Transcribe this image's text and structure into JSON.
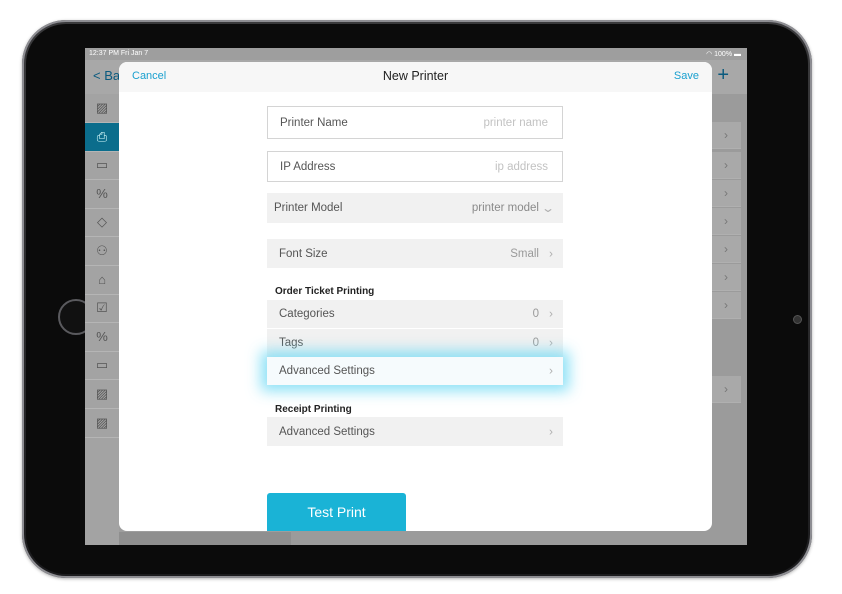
{
  "status_bar": {
    "time": "12:37 PM  Fri Jan 7",
    "battery": "100%"
  },
  "background": {
    "back_label": "< Ba",
    "add_label": "+"
  },
  "sidebar": {
    "items": [
      {
        "icon": "chart-icon",
        "glyph": "▨"
      },
      {
        "icon": "printer-icon",
        "glyph": "⎙",
        "active": true
      },
      {
        "icon": "tray-icon",
        "glyph": "▭"
      },
      {
        "icon": "discount-icon",
        "glyph": "%"
      },
      {
        "icon": "diamond-icon",
        "glyph": "◇"
      },
      {
        "icon": "users-icon",
        "glyph": "⚇"
      },
      {
        "icon": "store-icon",
        "glyph": "⌂"
      },
      {
        "icon": "clipboard-icon",
        "glyph": "☑"
      },
      {
        "icon": "percent-box-icon",
        "glyph": "%"
      },
      {
        "icon": "monitor-icon",
        "glyph": "▭"
      },
      {
        "icon": "chart-icon",
        "glyph": "▨"
      },
      {
        "icon": "chart-icon",
        "glyph": "▨"
      }
    ]
  },
  "modal": {
    "cancel": "Cancel",
    "title": "New Printer",
    "save": "Save",
    "printer_name": {
      "label": "Printer Name",
      "placeholder": "printer name"
    },
    "ip_address": {
      "label": "IP Address",
      "placeholder": "ip address"
    },
    "printer_model": {
      "label": "Printer Model",
      "value": "printer model"
    },
    "font_size": {
      "label": "Font Size",
      "value": "Small"
    },
    "order_ticket": {
      "heading": "Order Ticket Printing",
      "categories": {
        "label": "Categories",
        "value": "0"
      },
      "tags": {
        "label": "Tags",
        "value": "0"
      },
      "advanced": {
        "label": "Advanced Settings"
      }
    },
    "receipt": {
      "heading": "Receipt Printing",
      "advanced": {
        "label": "Advanced Settings"
      }
    },
    "test_print": "Test Print"
  },
  "colors": {
    "accent": "#1aa0cf",
    "button": "#1ab3d6",
    "sidebar_active": "#0b6d8c",
    "highlight_glow": "#78dcf5"
  }
}
